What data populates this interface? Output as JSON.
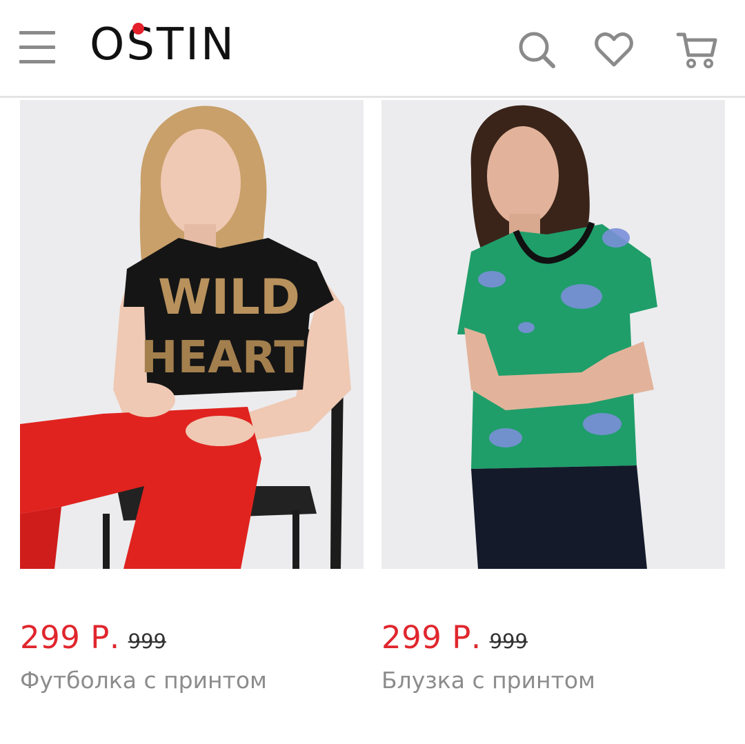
{
  "header": {
    "logo": "O'STIN",
    "logo_letters_rest": "STIN",
    "logo_first": "O",
    "brand_color": "#e4202a",
    "icons": [
      "menu-icon",
      "search-icon",
      "heart-icon",
      "cart-icon"
    ]
  },
  "products": [
    {
      "price": "299 Р.",
      "old_price": "999",
      "name": "Футболка с принтом",
      "print_text_line1": "WILD",
      "print_text_line2": "HEART"
    },
    {
      "price": "299 Р.",
      "old_price": "999",
      "name": "Блузка с принтом"
    }
  ],
  "colors": {
    "price": "#e0262d",
    "name": "#8c8c8c",
    "icon": "#8a8a8a"
  }
}
